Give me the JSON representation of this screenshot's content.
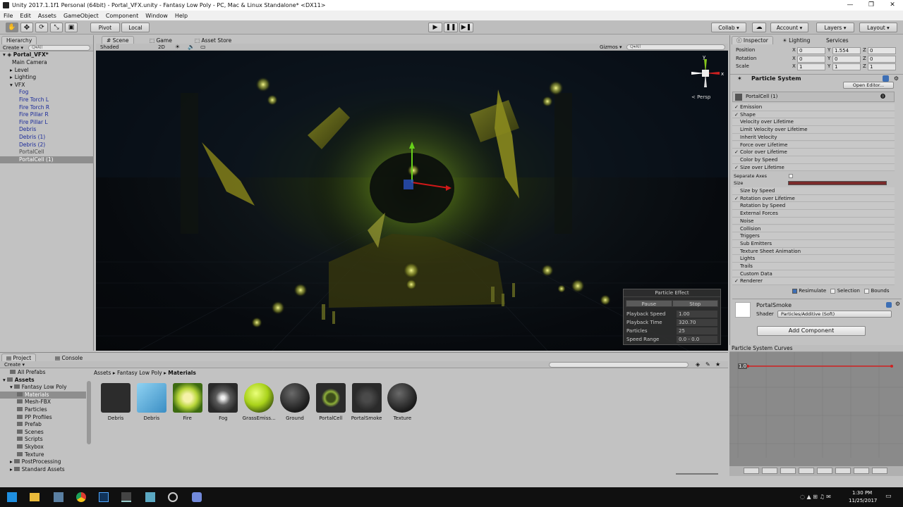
{
  "window": {
    "title": "Unity 2017.1.1f1 Personal (64bit) - Portal_VFX.unity - Fantasy Low Poly - PC, Mac & Linux Standalone* <DX11>",
    "controls": [
      "—",
      "❐",
      "✕"
    ]
  },
  "menu": [
    "File",
    "Edit",
    "Assets",
    "GameObject",
    "Component",
    "Window",
    "Help"
  ],
  "toolbar": {
    "pivot": "Pivot",
    "local": "Local",
    "collab": "Collab ▾",
    "account": "Account ▾",
    "layers": "Layers ▾",
    "layout": "Layout ▾"
  },
  "hierarchy": {
    "tab": "Hierarchy",
    "create": "Create ▾",
    "search_placeholder": "Q▾All",
    "scene": "Portal_VFX*",
    "items": [
      {
        "label": "Main Camera",
        "indent": 1,
        "color": "#111111"
      },
      {
        "label": "Level",
        "indent": 1,
        "color": "#111111",
        "arrow": "▸"
      },
      {
        "label": "Lighting",
        "indent": 1,
        "color": "#111111",
        "arrow": "▸"
      },
      {
        "label": "VFX",
        "indent": 1,
        "color": "#111111",
        "arrow": "▾"
      },
      {
        "label": "Fog",
        "indent": 2,
        "color": "#1a2a9a"
      },
      {
        "label": "Fire Torch L",
        "indent": 2,
        "color": "#1a2a9a"
      },
      {
        "label": "Fire Torch R",
        "indent": 2,
        "color": "#1a2a9a"
      },
      {
        "label": "Fire Pillar R",
        "indent": 2,
        "color": "#1a2a9a"
      },
      {
        "label": "Fire Pillar L",
        "indent": 2,
        "color": "#1a2a9a"
      },
      {
        "label": "Debris",
        "indent": 2,
        "color": "#1a2a9a"
      },
      {
        "label": "Debris (1)",
        "indent": 2,
        "color": "#1a2a9a"
      },
      {
        "label": "Debris (2)",
        "indent": 2,
        "color": "#1a2a9a"
      },
      {
        "label": "PortalCell",
        "indent": 2,
        "color": "#4a4a4a"
      },
      {
        "label": "PortalCell (1)",
        "indent": 2,
        "color": "#ffffff",
        "selected": true
      }
    ]
  },
  "scene": {
    "tabs": [
      "Scene",
      "Game",
      "Asset Store"
    ],
    "shading": "Shaded",
    "mode_2d": "2D",
    "gizmos": "Gizmos ▾",
    "search_placeholder": "Q▾All",
    "persp": "< Persp",
    "particle_effect": {
      "title": "Particle Effect",
      "pause": "Pause",
      "stop": "Stop",
      "rows": [
        {
          "label": "Playback Speed",
          "value": "1.00"
        },
        {
          "label": "Playback Time",
          "value": "320.70"
        },
        {
          "label": "Particles",
          "value": "25"
        },
        {
          "label": "Speed Range",
          "value": "0.0 - 0.0"
        }
      ]
    }
  },
  "inspector": {
    "tabs": [
      "Inspector",
      "Lighting",
      "Services"
    ],
    "transform": [
      {
        "label": "Position",
        "x": "0",
        "y": "1.554",
        "z": "0"
      },
      {
        "label": "Rotation",
        "x": "0",
        "y": "0",
        "z": "0"
      },
      {
        "label": "Scale",
        "x": "1",
        "y": "1",
        "z": "1"
      }
    ],
    "component_title": "Particle System",
    "open_editor": "Open Editor...",
    "system_name": "PortalCell (1)",
    "modules": [
      {
        "label": "Emission",
        "checked": true
      },
      {
        "label": "Shape",
        "checked": true
      },
      {
        "label": "Velocity over Lifetime",
        "checked": false
      },
      {
        "label": "Limit Velocity over Lifetime",
        "checked": false
      },
      {
        "label": "Inherit Velocity",
        "checked": false
      },
      {
        "label": "Force over Lifetime",
        "checked": false
      },
      {
        "label": "Color over Lifetime",
        "checked": true
      },
      {
        "label": "Color by Speed",
        "checked": false
      },
      {
        "label": "Size over Lifetime",
        "checked": true
      }
    ],
    "separate_axes": "Separate Axes",
    "size_label": "Size",
    "modules2": [
      {
        "label": "Size by Speed",
        "checked": false
      },
      {
        "label": "Rotation over Lifetime",
        "checked": true
      },
      {
        "label": "Rotation by Speed",
        "checked": false
      },
      {
        "label": "External Forces",
        "checked": false
      },
      {
        "label": "Noise",
        "checked": false
      },
      {
        "label": "Collision",
        "checked": false
      },
      {
        "label": "Triggers",
        "checked": false
      },
      {
        "label": "Sub Emitters",
        "checked": false
      },
      {
        "label": "Texture Sheet Animation",
        "checked": false
      },
      {
        "label": "Lights",
        "checked": false
      },
      {
        "label": "Trails",
        "checked": false
      },
      {
        "label": "Custom Data",
        "checked": false
      },
      {
        "label": "Renderer",
        "checked": true
      }
    ],
    "resimulate": "Resimulate",
    "selection": "Selection",
    "bounds": "Bounds",
    "material_name": "PortalSmoke",
    "shader_label": "Shader",
    "shader_value": "Particles/Additive (Soft)",
    "add_component": "Add Component"
  },
  "curves": {
    "title": "Particle System Curves",
    "value": "1.0"
  },
  "project": {
    "tabs": [
      "Project",
      "Console"
    ],
    "create": "Create ▾",
    "breadcrumb": [
      "Assets",
      "Fantasy Low Poly",
      "Materials"
    ],
    "tree": [
      {
        "label": "All Prefabs",
        "indent": 1,
        "arrow": ""
      },
      {
        "label": "Assets",
        "indent": 0,
        "arrow": "▾",
        "bold": true
      },
      {
        "label": "Fantasy Low Poly",
        "indent": 1,
        "arrow": "▾"
      },
      {
        "label": "Materials",
        "indent": 2,
        "arrow": "",
        "selected": true
      },
      {
        "label": "Mesh-FBX",
        "indent": 2,
        "arrow": ""
      },
      {
        "label": "Particles",
        "indent": 2,
        "arrow": ""
      },
      {
        "label": "PP Profiles",
        "indent": 2,
        "arrow": ""
      },
      {
        "label": "Prefab",
        "indent": 2,
        "arrow": ""
      },
      {
        "label": "Scenes",
        "indent": 2,
        "arrow": ""
      },
      {
        "label": "Scripts",
        "indent": 2,
        "arrow": ""
      },
      {
        "label": "Skybox",
        "indent": 2,
        "arrow": ""
      },
      {
        "label": "Texture",
        "indent": 2,
        "arrow": ""
      },
      {
        "label": "PostProcessing",
        "indent": 1,
        "arrow": "▸"
      },
      {
        "label": "Standard Assets",
        "indent": 1,
        "arrow": "▸"
      }
    ],
    "assets": [
      {
        "label": "Debris",
        "kind": "debris"
      },
      {
        "label": "Debris",
        "kind": "cube"
      },
      {
        "label": "Fire",
        "kind": "fire"
      },
      {
        "label": "Fog",
        "kind": "fog"
      },
      {
        "label": "GrassEmiss...",
        "kind": "grass"
      },
      {
        "label": "Ground",
        "kind": "ground"
      },
      {
        "label": "PortalCell",
        "kind": "portalcell"
      },
      {
        "label": "PortalSmoke",
        "kind": "portalsmoke"
      },
      {
        "label": "Texture",
        "kind": "texture"
      }
    ]
  },
  "taskbar": {
    "time": "1:30 PM",
    "date": "11/25/2017"
  },
  "colors": {
    "selection": "#3d6fb5",
    "hier_selected": "#8e8e8e",
    "scene_dark": "#05070a",
    "glow": "#c8d23a"
  }
}
